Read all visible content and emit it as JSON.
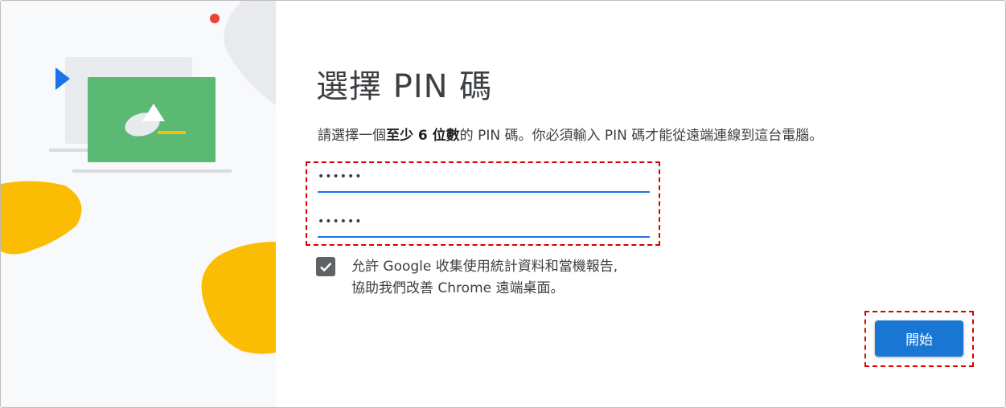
{
  "dialog": {
    "title": "選擇 PIN 碼",
    "description": {
      "part1": "請選擇一個",
      "bold1": "至少 6 位數",
      "part2": "的 PIN 碼。你必須輸入 PIN 碼才能從遠端連線到這台電腦。"
    },
    "pin_field": {
      "value": "••••••"
    },
    "confirm_pin_field": {
      "value": "••••••"
    },
    "consent": {
      "checked": true,
      "line1": "允許 Google 收集使用統計資料和當機報告,",
      "line2": "協助我們改善 Chrome 遠端桌面。"
    },
    "start_button_label": "開始"
  },
  "colors": {
    "accent": "#1976d2",
    "field_underline": "#1a73e8",
    "highlight": "#d50000",
    "illustration_green": "#5bb974",
    "illustration_yellow": "#fbbc04",
    "illustration_red": "#ea4335",
    "illustration_blue": "#1a73e8"
  },
  "icons": {
    "checkbox": "check-icon",
    "illustration": "remote-desktop-illustration"
  }
}
